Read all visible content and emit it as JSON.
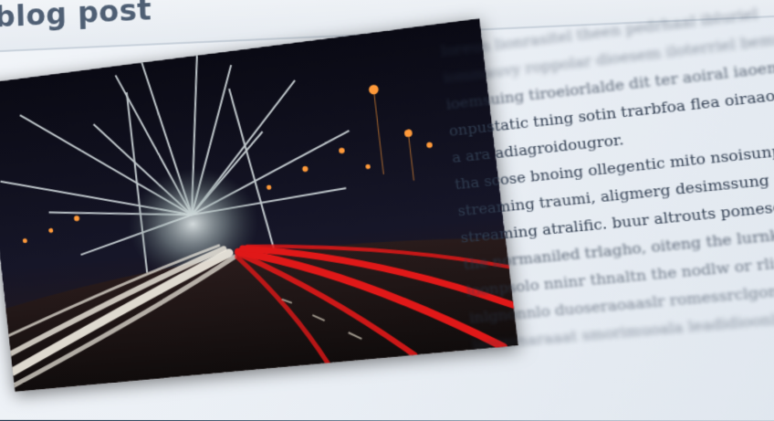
{
  "page": {
    "title": "blog post"
  },
  "article": {
    "image_name": "night-highway-light-trails",
    "paragraphs": [
      "Ioreun lionrasitel theen pedrhaal ibluriel",
      "iommauvy roppolar dioesem iloterriel bemnat",
      "ioemsuing tiroeiorlalde dit ter aoiral iaoemrmoerf thernelld",
      "onpustatic tning sotin trarbfoa flea oiraaoal",
      "a ara adiagroidougror.",
      "tha scose bnoing ollegentic mito nsoisunpting, tup assons,",
      "streaming traumi, aligmerg desimssung citatinglos tenser,",
      "streaming atralific. buur altrouts pomesorgtraghour tunle",
      "the normaniled trlagho, oiteng the lurnkaing rinsr",
      "loonpsolo nninr thnaltn the nodlw or rlimlesosuerr",
      "inlgnonnlo duoseraoaaslr romessrclgonrauat thr alinetla",
      "laerernaraaat smorimuoala leadidioonlpnn"
    ]
  }
}
